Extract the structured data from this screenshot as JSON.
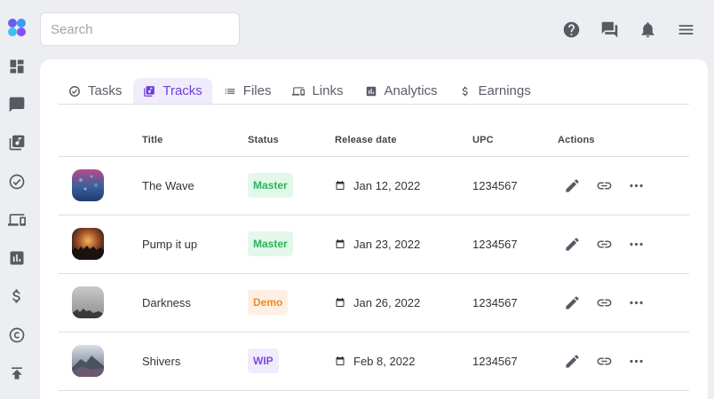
{
  "search": {
    "placeholder": "Search"
  },
  "sidebar": {
    "items": [
      {
        "icon": "dashboard-icon"
      },
      {
        "icon": "chat-icon"
      },
      {
        "icon": "music-library-icon"
      },
      {
        "icon": "check-circle-icon"
      },
      {
        "icon": "devices-icon"
      },
      {
        "icon": "analytics-icon"
      },
      {
        "icon": "dollar-icon"
      },
      {
        "icon": "copyright-icon"
      },
      {
        "icon": "upload-icon"
      }
    ]
  },
  "header": {
    "icons": [
      "help-icon",
      "forum-icon",
      "bell-icon",
      "menu-icon"
    ]
  },
  "tabs": [
    {
      "label": "Tasks",
      "icon": "check-circle-icon"
    },
    {
      "label": "Tracks",
      "icon": "music-library-icon",
      "active": true
    },
    {
      "label": "Files",
      "icon": "list-icon"
    },
    {
      "label": "Links",
      "icon": "devices-icon"
    },
    {
      "label": "Analytics",
      "icon": "analytics-icon"
    },
    {
      "label": "Earnings",
      "icon": "dollar-icon"
    }
  ],
  "table": {
    "columns": [
      "Title",
      "Status",
      "Release date",
      "UPC",
      "Actions"
    ],
    "rows": [
      {
        "title": "The Wave",
        "status": "Master",
        "release_date": "Jan 12, 2022",
        "upc": "1234567"
      },
      {
        "title": "Pump it up",
        "status": "Master",
        "release_date": "Jan 23, 2022",
        "upc": "1234567"
      },
      {
        "title": "Darkness",
        "status": "Demo",
        "release_date": "Jan 26, 2022",
        "upc": "1234567"
      },
      {
        "title": "Shivers",
        "status": "WIP",
        "release_date": "Feb 8, 2022",
        "upc": "1234567"
      }
    ]
  },
  "colors": {
    "accent": "#6d3fdc",
    "master_bg": "#e3f8ea",
    "master_fg": "#27b45a",
    "demo_bg": "#fdf0e3",
    "demo_fg": "#ef8a24",
    "wip_bg": "#f1ecfc",
    "wip_fg": "#7c4ae0"
  }
}
